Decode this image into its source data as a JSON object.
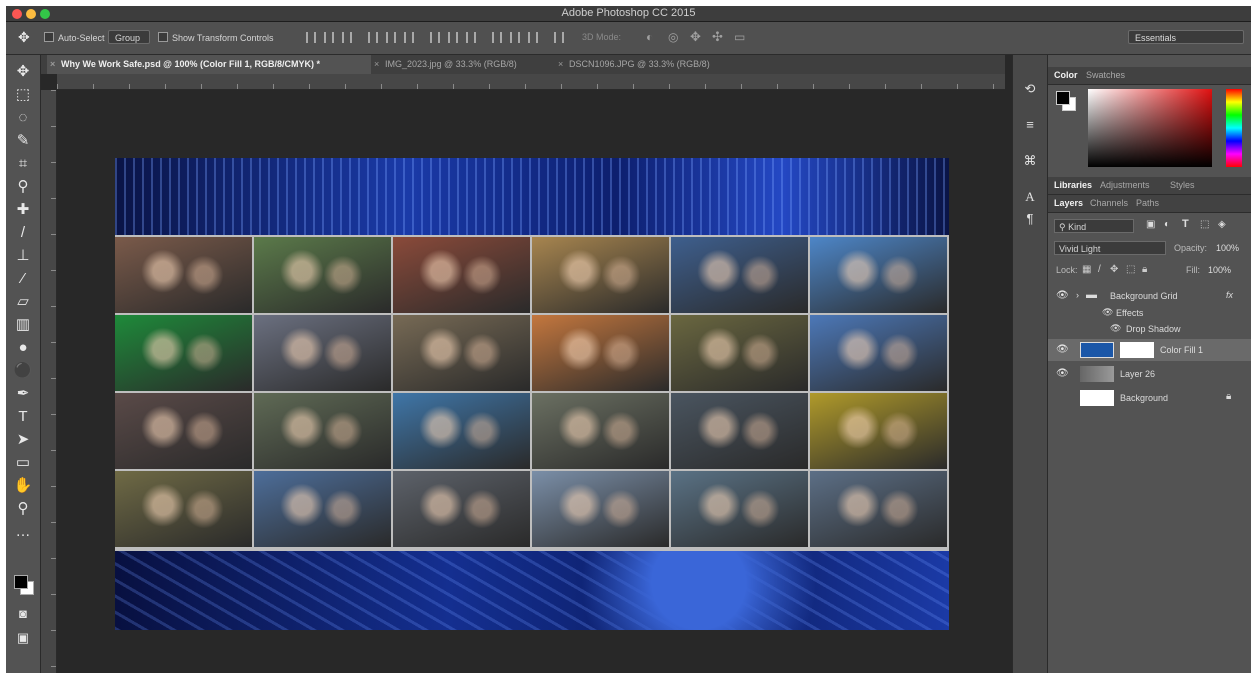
{
  "window": {
    "title": "Adobe Photoshop CC 2015"
  },
  "options_bar": {
    "auto_select_label": "Auto-Select",
    "auto_select_target": "Group",
    "show_transform_label": "Show Transform Controls",
    "mode_3d_label": "3D Mode:",
    "workspace": "Essentials"
  },
  "tabs": [
    {
      "label": "Why We Work Safe.psd @ 100% (Color Fill 1, RGB/8/CMYK) *",
      "active": true
    },
    {
      "label": "IMG_2023.jpg @ 33.3% (RGB/8)",
      "active": false
    },
    {
      "label": "DSCN1096.JPG @ 33.3% (RGB/8)",
      "active": false
    }
  ],
  "toolbar": {
    "tools": [
      {
        "icon": "move-icon",
        "glyph": "✥"
      },
      {
        "icon": "marquee-icon",
        "glyph": "⬚"
      },
      {
        "icon": "lasso-icon",
        "glyph": "◌"
      },
      {
        "icon": "quick-select-icon",
        "glyph": "✎"
      },
      {
        "icon": "crop-icon",
        "glyph": "⌗"
      },
      {
        "icon": "eyedropper-icon",
        "glyph": "⚲"
      },
      {
        "icon": "healing-icon",
        "glyph": "✚"
      },
      {
        "icon": "brush-icon",
        "glyph": "/"
      },
      {
        "icon": "stamp-icon",
        "glyph": "⊥"
      },
      {
        "icon": "history-brush-icon",
        "glyph": "⁄"
      },
      {
        "icon": "eraser-icon",
        "glyph": "▱"
      },
      {
        "icon": "gradient-icon",
        "glyph": "▥"
      },
      {
        "icon": "blur-icon",
        "glyph": "●"
      },
      {
        "icon": "dodge-icon",
        "glyph": "⚫"
      },
      {
        "icon": "pen-icon",
        "glyph": "✒"
      },
      {
        "icon": "type-icon",
        "glyph": "T"
      },
      {
        "icon": "path-select-icon",
        "glyph": "➤"
      },
      {
        "icon": "rectangle-icon",
        "glyph": "▭"
      },
      {
        "icon": "hand-icon",
        "glyph": "✋"
      },
      {
        "icon": "zoom-icon",
        "glyph": "⚲"
      },
      {
        "icon": "more-tools-icon",
        "glyph": "…"
      }
    ]
  },
  "colors": {
    "foreground": "#000000",
    "background": "#ffffff",
    "accent_layer_fill": "#1b57a8"
  },
  "right_panels": {
    "color_tabs": [
      "Color",
      "Swatches"
    ],
    "library_tabs": [
      "Libraries",
      "Adjustments",
      "Styles"
    ],
    "layer_tabs": [
      "Layers",
      "Channels",
      "Paths"
    ],
    "filter_kind": "Kind",
    "blend_mode": "Vivid Light",
    "opacity_label": "Opacity:",
    "opacity_value": "100%",
    "lock_label": "Lock:",
    "fill_label": "Fill:",
    "fill_value": "100%",
    "layers": [
      {
        "name": "Background Grid",
        "type": "group",
        "fx": "fx"
      },
      {
        "name": "Effects",
        "type": "effects"
      },
      {
        "name": "Drop Shadow",
        "type": "effect"
      },
      {
        "name": "Color Fill 1",
        "type": "fill",
        "selected": true
      },
      {
        "name": "Layer 26",
        "type": "pixel"
      },
      {
        "name": "Background",
        "type": "background",
        "locked": true
      }
    ]
  },
  "photos": [
    "#7a5a4a",
    "#5b7a4a",
    "#8a4a3a",
    "#a7854f",
    "#3e5f8e",
    "#4d86c8",
    "#1e8a3a",
    "#6b7080",
    "#776a55",
    "#c4773e",
    "#6a6740",
    "#4c78b8",
    "#5a4a48",
    "#5f6a55",
    "#3f76a8",
    "#6b7062",
    "#4a5560",
    "#b09a2a",
    "#6f6a45",
    "#4d6e9a",
    "#5d626a",
    "#7b8fa8",
    "#5a7285",
    "#5c6f86"
  ]
}
